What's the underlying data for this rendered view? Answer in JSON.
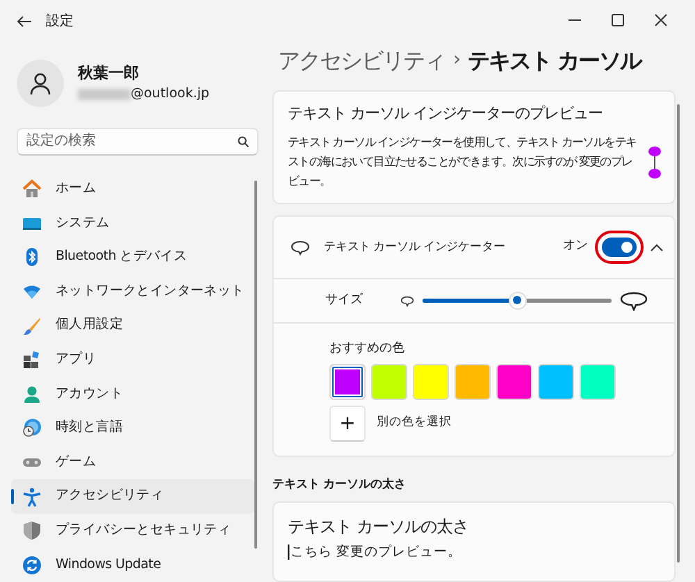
{
  "window": {
    "title": "設定"
  },
  "profile": {
    "name": "秋葉一郎",
    "email": "@outlook.jp"
  },
  "search": {
    "placeholder": "設定の検索"
  },
  "nav": [
    {
      "label": "ホーム",
      "selected": false
    },
    {
      "label": "システム",
      "selected": false
    },
    {
      "label": "Bluetooth とデバイス",
      "selected": false
    },
    {
      "label": "ネットワークとインターネット",
      "selected": false
    },
    {
      "label": "個人用設定",
      "selected": false
    },
    {
      "label": "アプリ",
      "selected": false
    },
    {
      "label": "アカウント",
      "selected": false
    },
    {
      "label": "時刻と言語",
      "selected": false
    },
    {
      "label": "ゲーム",
      "selected": false
    },
    {
      "label": "アクセシビリティ",
      "selected": true
    },
    {
      "label": "プライバシーとセキュリティ",
      "selected": false
    },
    {
      "label": "Windows Update",
      "selected": false
    }
  ],
  "breadcrumb": {
    "parent": "アクセシビリティ",
    "separator": "›",
    "current": "テキスト カーソル"
  },
  "preview_card": {
    "title": "テキスト カーソル インジケーターのプレビュー",
    "description": "テキスト カーソル インジケーターを使用して、テキスト カーソルをテキストの海において目立たせることができます。次に示すのが 変更のプレビュー。"
  },
  "indicator": {
    "label": "テキスト カーソル インジケーター",
    "state_label": "オン",
    "on": true,
    "highlighted": true,
    "expanded": true
  },
  "size": {
    "label": "サイズ",
    "level": 0.5
  },
  "colors": {
    "label": "おすすめの色",
    "swatches": [
      {
        "color": "#c000ff",
        "selected": true
      },
      {
        "color": "#c0ff00",
        "selected": false
      },
      {
        "color": "#ffff00",
        "selected": false
      },
      {
        "color": "#ffb900",
        "selected": false
      },
      {
        "color": "#ff00c8",
        "selected": false
      },
      {
        "color": "#00bfff",
        "selected": false
      },
      {
        "color": "#00ffc0",
        "selected": false
      }
    ],
    "custom_icon": "+",
    "custom": "別の色を選択"
  },
  "thickness": {
    "section": "テキスト カーソルの太さ",
    "title": "テキスト カーソルの太さ",
    "preview": "こちら 変更のプレビュー。"
  }
}
